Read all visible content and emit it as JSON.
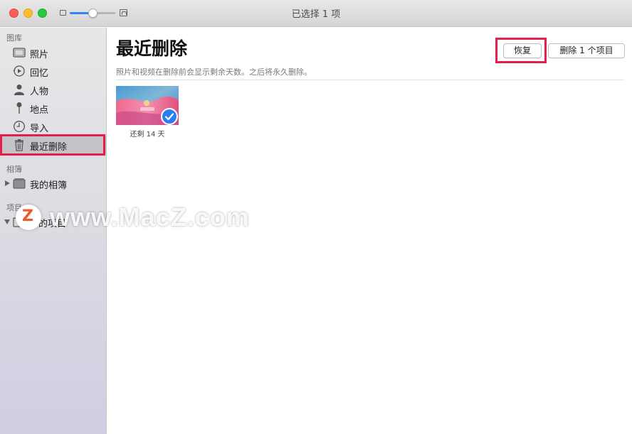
{
  "window": {
    "title": "已选择 1 项",
    "zoom_level": 0.5
  },
  "sidebar": {
    "library_header": "图库",
    "library_items": [
      {
        "label": "照片",
        "icon": "photos-icon"
      },
      {
        "label": "回忆",
        "icon": "memories-icon"
      },
      {
        "label": "人物",
        "icon": "person-icon"
      },
      {
        "label": "地点",
        "icon": "pin-icon"
      },
      {
        "label": "导入",
        "icon": "clock-icon"
      },
      {
        "label": "最近删除",
        "icon": "trash-icon",
        "selected": true
      }
    ],
    "albums_header": "相簿",
    "albums_items": [
      {
        "label": "我的相簿",
        "icon": "album-icon"
      }
    ],
    "projects_header": "项目",
    "projects_items": [
      {
        "label": "的项目",
        "icon": "project-icon"
      }
    ]
  },
  "main": {
    "title": "最近删除",
    "subtitle": "照片和视频在删除前会显示剩余天数。之后将永久删除。",
    "recover_button": "恢复",
    "delete_button": "删除 1 个项目",
    "items": [
      {
        "caption": "还剩 14 天",
        "selected": true
      }
    ]
  },
  "watermark": {
    "logo": "Z",
    "text": "www.MacZ.com"
  },
  "colors": {
    "highlight": "#e81d4b",
    "accent": "#2d84f6",
    "check": "#2a7ff0"
  }
}
